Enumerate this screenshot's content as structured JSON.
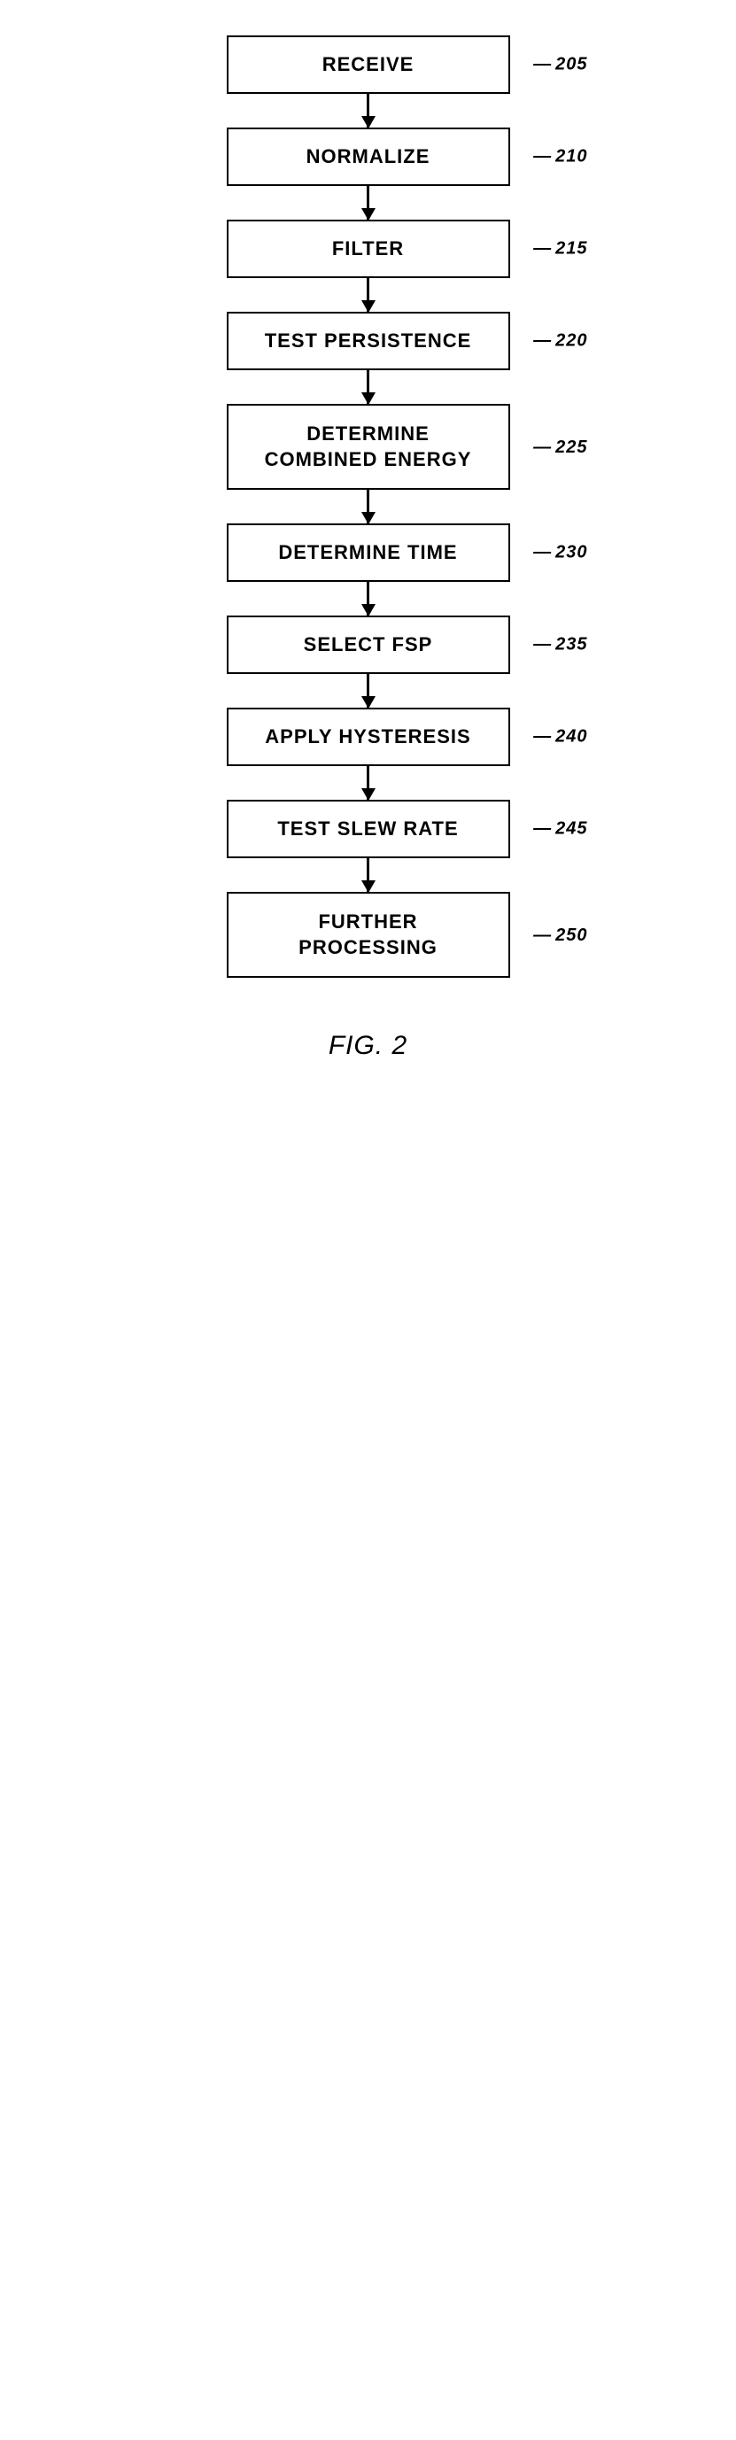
{
  "flowchart": {
    "steps": [
      {
        "id": "receive",
        "label": "RECEIVE",
        "number": "205"
      },
      {
        "id": "normalize",
        "label": "NORMALIZE",
        "number": "210"
      },
      {
        "id": "filter",
        "label": "FILTER",
        "number": "215"
      },
      {
        "id": "test-persistence",
        "label": "TEST PERSISTENCE",
        "number": "220"
      },
      {
        "id": "determine-combined-energy",
        "label": "DETERMINE\nCOMBINED ENERGY",
        "number": "225"
      },
      {
        "id": "determine-time",
        "label": "DETERMINE TIME",
        "number": "230"
      },
      {
        "id": "select-fsp",
        "label": "SELECT FSP",
        "number": "235"
      },
      {
        "id": "apply-hysteresis",
        "label": "APPLY HYSTERESIS",
        "number": "240"
      },
      {
        "id": "test-slew-rate",
        "label": "TEST SLEW RATE",
        "number": "245"
      },
      {
        "id": "further-processing",
        "label": "FURTHER\nPROCESSING",
        "number": "250"
      }
    ],
    "caption": "FIG. 2"
  }
}
